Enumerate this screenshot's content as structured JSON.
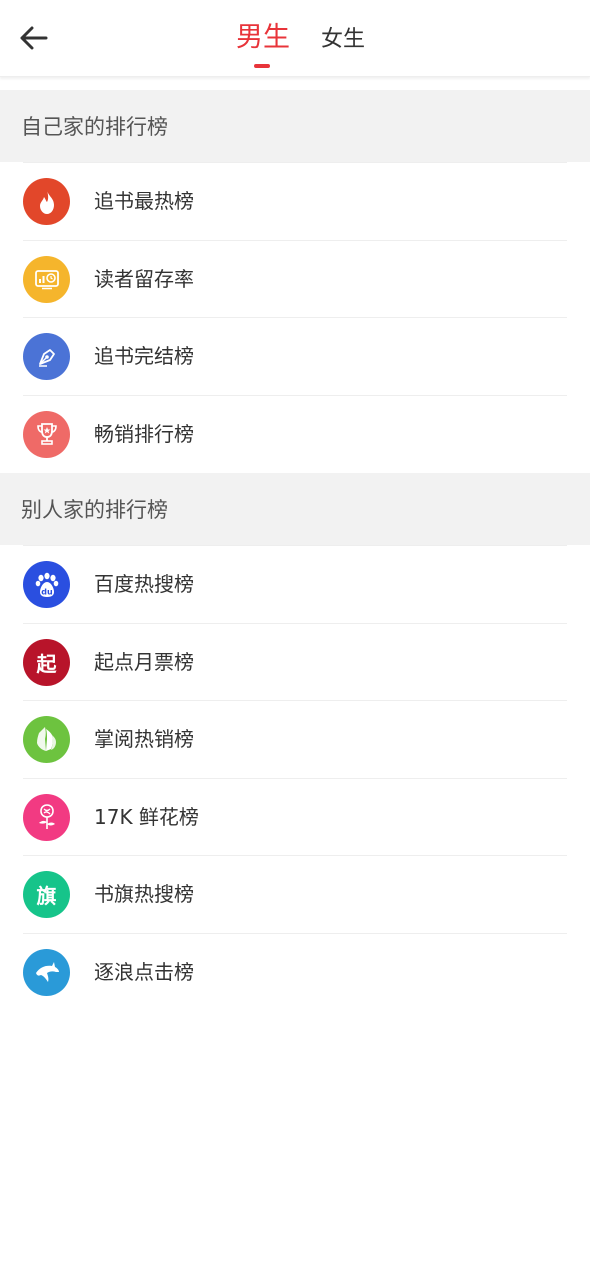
{
  "header": {
    "tabs": [
      {
        "label": "男生",
        "active": true
      },
      {
        "label": "女生",
        "active": false
      }
    ],
    "active_color": "#e8343a",
    "inactive_color": "#333333"
  },
  "sections": [
    {
      "title": "自己家的排行榜",
      "items": [
        {
          "label": "追书最热榜",
          "icon": "flame-icon",
          "color": "#e2472a"
        },
        {
          "label": "读者留存率",
          "icon": "chart-clock-icon",
          "color": "#f5b52c"
        },
        {
          "label": "追书完结榜",
          "icon": "pen-nib-icon",
          "color": "#4b73d6"
        },
        {
          "label": "畅销排行榜",
          "icon": "trophy-icon",
          "color": "#ef6a67"
        }
      ]
    },
    {
      "title": "别人家的排行榜",
      "items": [
        {
          "label": "百度热搜榜",
          "icon": "baidu-paw-icon",
          "color": "#2a4fe0",
          "glyph": "du"
        },
        {
          "label": "起点月票榜",
          "icon": "qidian-icon",
          "color": "#b8142a",
          "glyph": "起"
        },
        {
          "label": "掌阅热销榜",
          "icon": "zhangyue-leaf-icon",
          "color": "#6dc33f"
        },
        {
          "label": "17K 鲜花榜",
          "icon": "rose-icon",
          "color": "#f23a82"
        },
        {
          "label": "书旗热搜榜",
          "icon": "shuqi-icon",
          "color": "#16c48a",
          "glyph": "旗"
        },
        {
          "label": "逐浪点击榜",
          "icon": "dolphin-icon",
          "color": "#2a9ad8"
        }
      ]
    }
  ]
}
